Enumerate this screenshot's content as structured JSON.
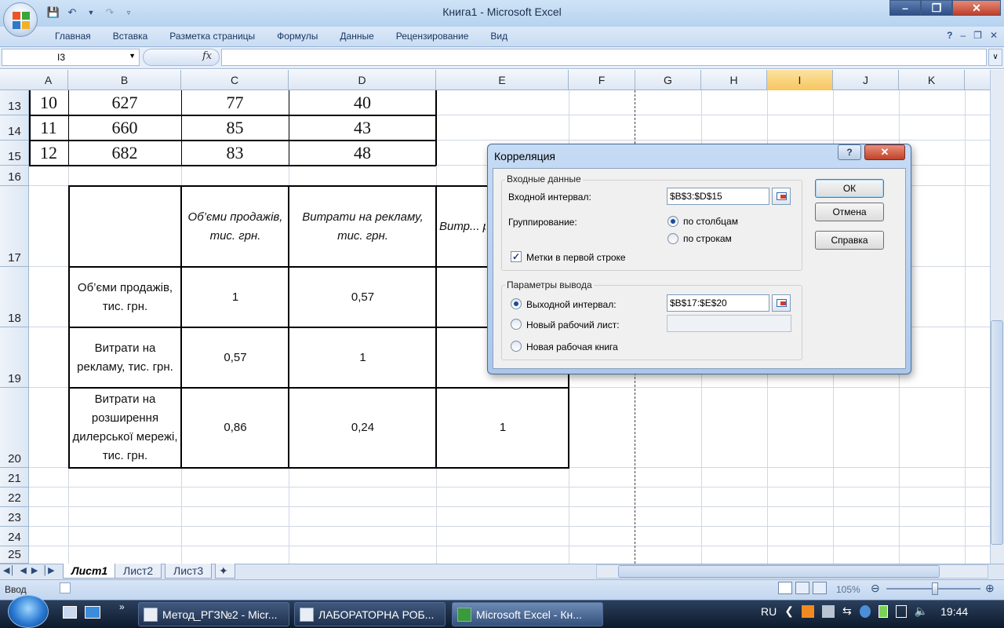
{
  "window": {
    "title": "Книга1 - Microsoft Excel"
  },
  "ribbon": {
    "tabs": [
      "Главная",
      "Вставка",
      "Разметка страницы",
      "Формулы",
      "Данные",
      "Рецензирование",
      "Вид"
    ]
  },
  "formula_bar": {
    "name_box": "I3",
    "fx": "fx",
    "formula": ""
  },
  "grid": {
    "columns": [
      "A",
      "B",
      "C",
      "D",
      "E",
      "F",
      "G",
      "H",
      "I",
      "J",
      "K"
    ],
    "selected_column": "I",
    "rows": [
      "13",
      "14",
      "15",
      "16",
      "17",
      "18",
      "19",
      "20",
      "21",
      "22",
      "23",
      "24",
      "25"
    ],
    "data_rows": [
      {
        "a": "10",
        "b": "627",
        "c": "77",
        "d": "40"
      },
      {
        "a": "11",
        "b": "660",
        "c": "85",
        "d": "43"
      },
      {
        "a": "12",
        "b": "682",
        "c": "83",
        "d": "48"
      }
    ],
    "corr_header": {
      "c": "Об’єми продажів, тис. грн.",
      "d": "Витрати на рекламу, тис. грн.",
      "e": "Витр... розш... дилерсь... ти..."
    },
    "corr_rows": [
      {
        "label": "Об’єми продажів, тис. грн.",
        "c": "1",
        "d": "",
        "e": ""
      },
      {
        "label": "Витрати на рекламу, тис. грн.",
        "c": "0,57",
        "d": "1",
        "e": ""
      },
      {
        "label": "Витрати на розширення дилерської мережі, тис. грн.",
        "c": "0,86",
        "d": "0,24",
        "e": "1"
      }
    ],
    "corr_row18_d": "0,57"
  },
  "sheets": [
    "Лист1",
    "Лист2",
    "Лист3"
  ],
  "active_sheet": "Лист1",
  "status": {
    "mode": "Ввод",
    "zoom": "105%"
  },
  "dialog": {
    "title": "Корреляция",
    "input_group": "Входные данные",
    "input_range_label": "Входной интервал:",
    "input_range": "$B$3:$D$15",
    "grouping_label": "Группирование:",
    "by_columns": "по столбцам",
    "by_rows": "по строкам",
    "labels_first_row": "Метки в первой строке",
    "output_group": "Параметры вывода",
    "output_range_label": "Выходной интервал:",
    "output_range": "$B$17:$E$20",
    "new_sheet_label": "Новый рабочий лист:",
    "new_workbook_label": "Новая рабочая книга",
    "ok": "ОК",
    "cancel": "Отмена",
    "help": "Справка"
  },
  "taskbar": {
    "items": [
      "Метод_РГЗ№2 - Micr...",
      "ЛАБОРАТОРНА РОБ...",
      "Microsoft Excel - Кн..."
    ],
    "lang": "RU",
    "time": "19:44"
  }
}
